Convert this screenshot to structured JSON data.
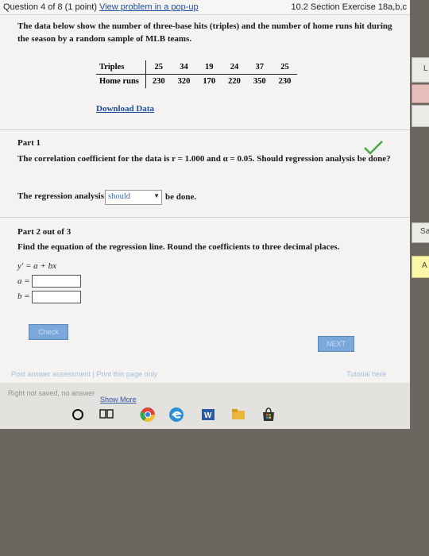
{
  "header": {
    "question_info": "Question 4 of 8 (1 point)",
    "popup_link": "View problem in a pop-up",
    "section": "10.2 Section Exercise 18a,b,c"
  },
  "prompt": "The data below show the number of three-base hits (triples) and the number of home runs hit during the season by a random sample of MLB teams.",
  "table": {
    "row1_label": "Triples",
    "row1_values": [
      "25",
      "34",
      "19",
      "24",
      "37",
      "25"
    ],
    "row2_label": "Home runs",
    "row2_values": [
      "230",
      "320",
      "170",
      "220",
      "350",
      "230"
    ]
  },
  "download_link": "Download Data",
  "part1": {
    "title": "Part 1",
    "text": "The correlation coefficient for the data is r = 1.000 and α = 0.05. Should regression analysis be done?",
    "regression_label": "The regression analysis",
    "selected_value": "should",
    "suffix": "be done."
  },
  "part2": {
    "title": "Part 2 out of 3",
    "text": "Find the equation of the regression line. Round the coefficients to three decimal places.",
    "equation": "y' = a + bx",
    "a_label": "a =",
    "b_label": "b ="
  },
  "buttons": {
    "check": "Check",
    "next": "NEXT"
  },
  "footer": {
    "links": "Post answer assessment | Print this page only",
    "tutorial": "Tutorial here",
    "faded_text": "Right not saved, no answer",
    "show_more": "Show More"
  },
  "side_tabs": {
    "tab1": "L",
    "tab2": "Sa",
    "tab3": "A"
  }
}
